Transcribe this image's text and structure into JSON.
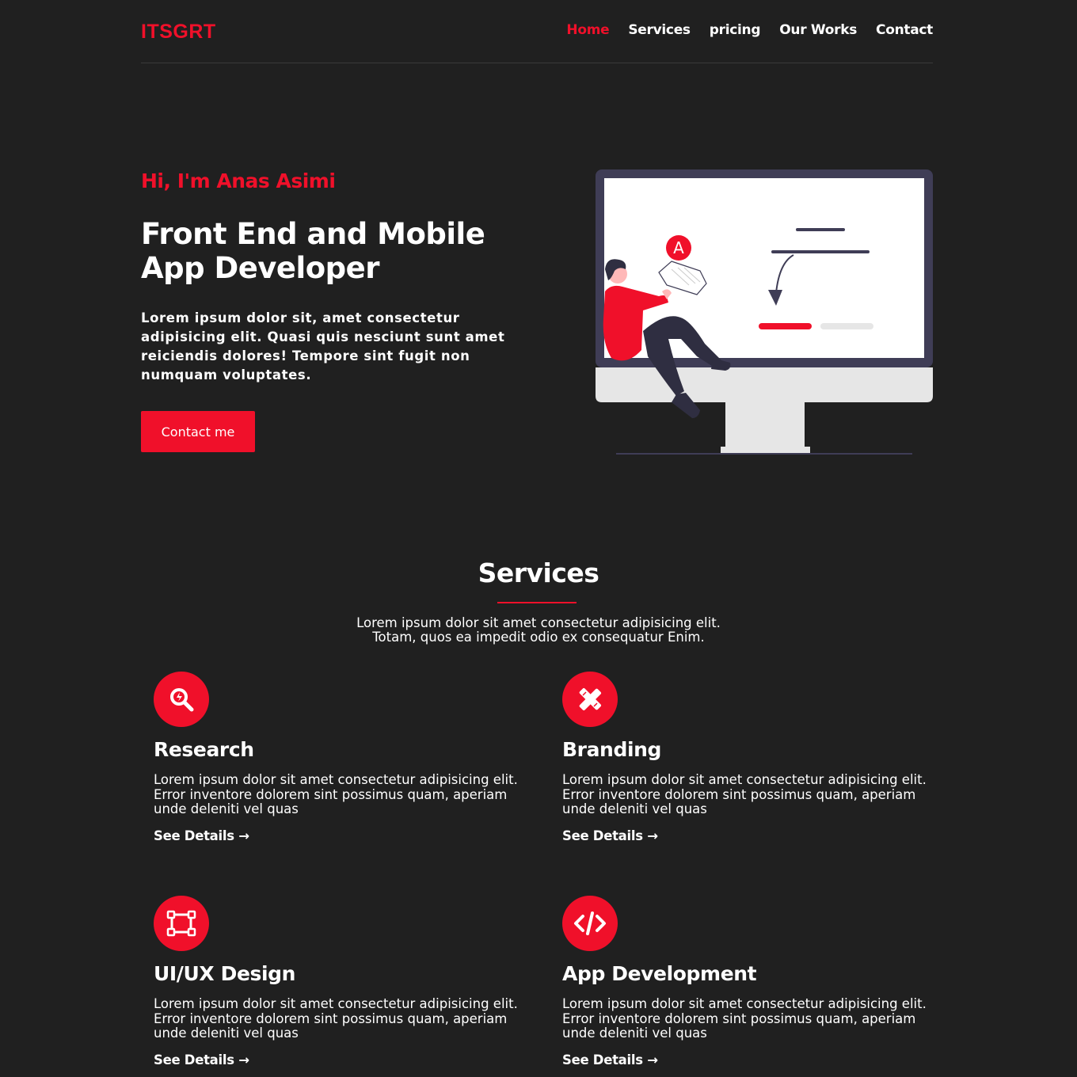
{
  "colors": {
    "accent": "#f0102a",
    "background": "#202020",
    "text": "#ffffff"
  },
  "header": {
    "logo": "ITSGRT",
    "nav": [
      {
        "label": "Home",
        "active": true
      },
      {
        "label": "Services"
      },
      {
        "label": "pricing"
      },
      {
        "label": "Our Works"
      },
      {
        "label": "Contact"
      }
    ]
  },
  "hero": {
    "greeting": "Hi, I'm Anas Asimi",
    "title": "Front End and Mobile App Developer",
    "text": "Lorem ipsum dolor sit, amet consectetur adipisicing elit. Quasi quis nesciunt sunt amet reiciendis dolores! Tempore sint fugit non numquam voluptates.",
    "button": "Contact me",
    "illustration_letter": "A"
  },
  "services": {
    "title": "Services",
    "subtitle_line1": "Lorem ipsum dolor sit amet consectetur adipisicing elit.",
    "subtitle_line2": "Totam, quos ea impedit odio ex consequatur Enim.",
    "items": [
      {
        "icon": "search-icon",
        "title": "Research",
        "text": "Lorem ipsum dolor sit amet consectetur adipisicing elit. Error inventore dolorem sint possimus quam, aperiam unde deleniti vel quas",
        "link": "See Details"
      },
      {
        "icon": "pencil-ruler-icon",
        "title": "Branding",
        "text": "Lorem ipsum dolor sit amet consectetur adipisicing elit. Error inventore dolorem sint possimus quam, aperiam unde deleniti vel quas",
        "link": "See Details"
      },
      {
        "icon": "vector-square-icon",
        "title": "UI/UX Design",
        "text": "Lorem ipsum dolor sit amet consectetur adipisicing elit. Error inventore dolorem sint possimus quam, aperiam unde deleniti vel quas",
        "link": "See Details"
      },
      {
        "icon": "code-icon",
        "title": "App Development",
        "text": "Lorem ipsum dolor sit amet consectetur adipisicing elit. Error inventore dolorem sint possimus quam, aperiam unde deleniti vel quas",
        "link": "See Details"
      }
    ]
  }
}
